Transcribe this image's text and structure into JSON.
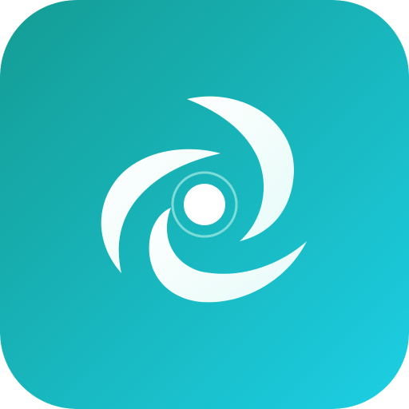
{
  "icon": {
    "name": "swirl-logo-icon",
    "colors": {
      "gradient_start": "#149C94",
      "gradient_end": "#1CCFE4",
      "blade_light": "#E6FBF8",
      "blade_white": "#FFFFFF",
      "ring": "#8FE3DC",
      "center": "#FFFFFF"
    }
  }
}
